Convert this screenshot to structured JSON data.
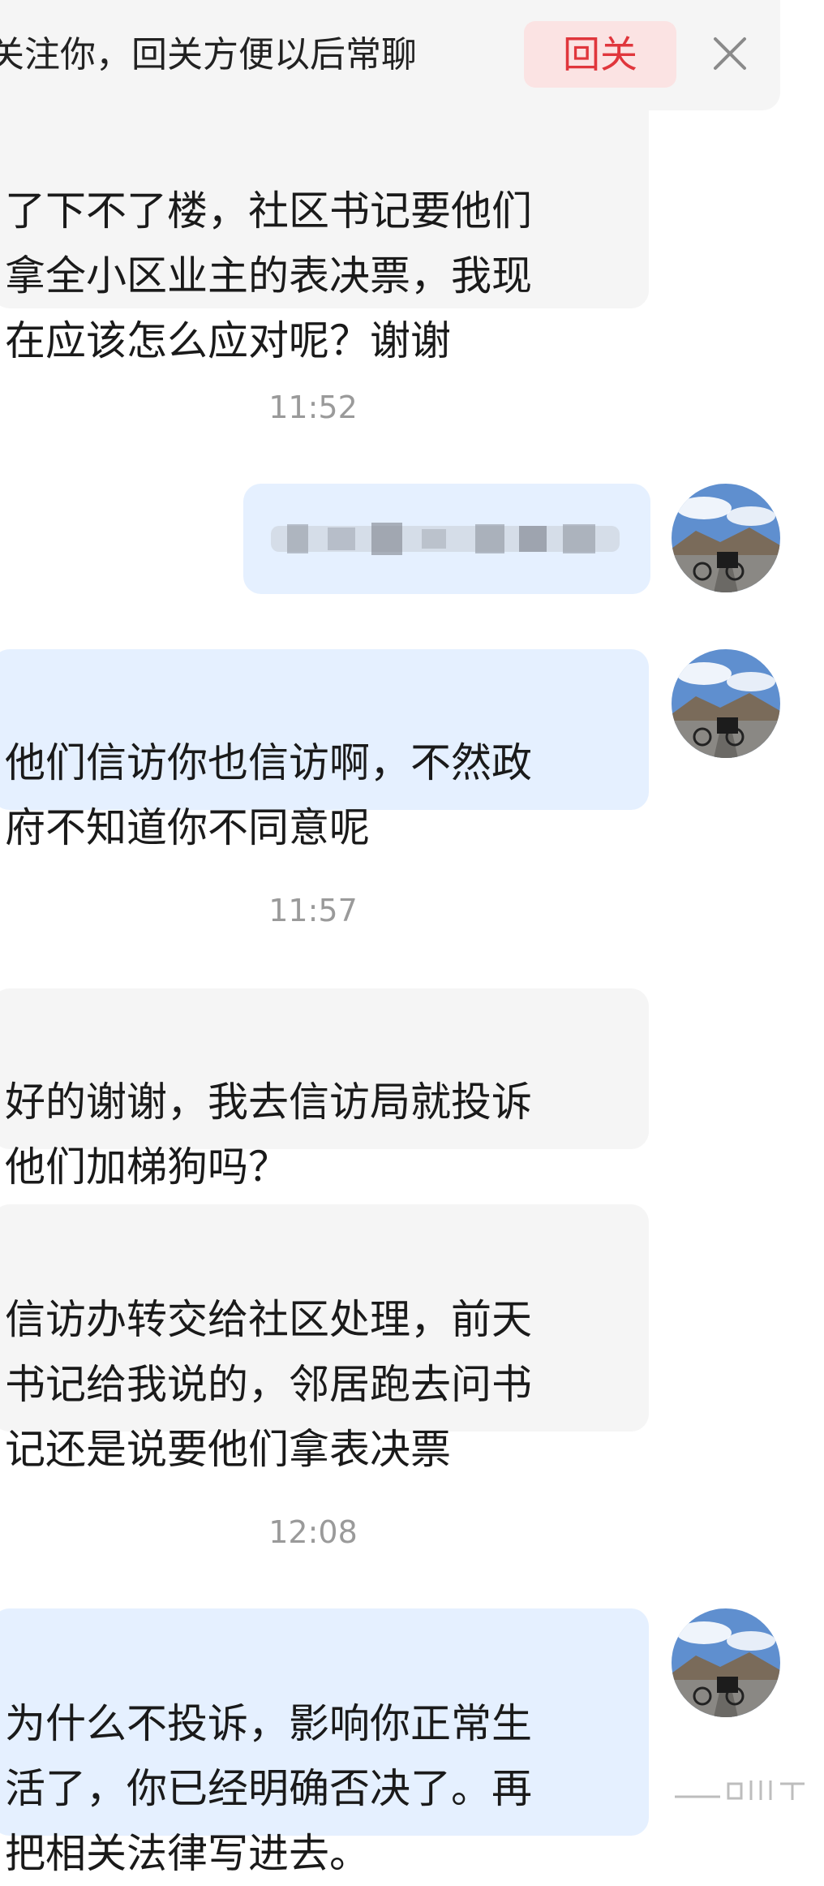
{
  "banner": {
    "text": "关注你，回关方便以后常聊",
    "follow_back_label": "回关",
    "close_icon": "close-icon"
  },
  "messages": [
    {
      "id": "m1",
      "side": "incoming",
      "text": "了下不了楼，社区书记要他们\n拿全小区业主的表决票，我现\n在应该怎么应对呢？谢谢"
    },
    {
      "id": "t1",
      "type": "timestamp",
      "text": "11:52"
    },
    {
      "id": "m2",
      "side": "outgoing",
      "text": "",
      "redacted": true
    },
    {
      "id": "m3",
      "side": "outgoing",
      "text": "他们信访你也信访啊，不然政\n府不知道你不同意呢"
    },
    {
      "id": "t2",
      "type": "timestamp",
      "text": "11:57"
    },
    {
      "id": "m4",
      "side": "incoming",
      "text": "好的谢谢，我去信访局就投诉\n他们加梯狗吗？"
    },
    {
      "id": "m5",
      "side": "incoming",
      "text": "信访办转交给社区处理，前天\n书记给我说的，邻居跑去问书\n记还是说要他们拿表决票"
    },
    {
      "id": "t3",
      "type": "timestamp",
      "text": "12:08"
    },
    {
      "id": "m6",
      "side": "outgoing",
      "text": "为什么不投诉，影响你正常生\n活了，你已经明确否决了。再\n把相关法律写进去。"
    }
  ],
  "colors": {
    "incoming_bubble": "#f5f5f5",
    "outgoing_bubble": "#e5f0ff",
    "follow_back_bg": "#fbe3e3",
    "follow_back_text": "#e0363c",
    "timestamp": "#9a9a9a"
  }
}
